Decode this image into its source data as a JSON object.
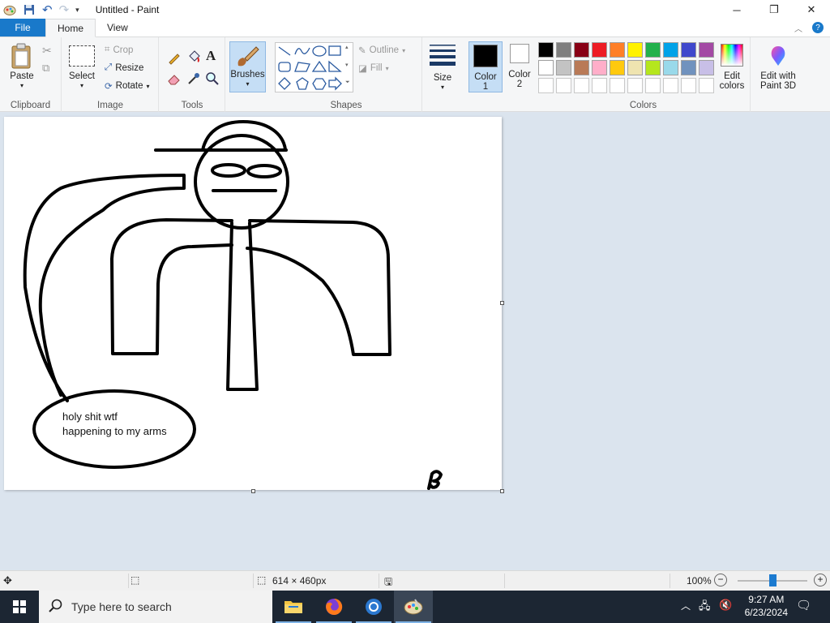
{
  "window": {
    "title": "Untitled - Paint",
    "minimize": "─",
    "maximize": "❐",
    "close": "✕"
  },
  "tabs": [
    {
      "label": "File"
    },
    {
      "label": "Home"
    },
    {
      "label": "View"
    }
  ],
  "ribbon": {
    "clipboard": {
      "group_label": "Clipboard",
      "paste": "Paste"
    },
    "image": {
      "group_label": "Image",
      "select": "Select",
      "crop": "Crop",
      "resize": "Resize",
      "rotate": "Rotate"
    },
    "tools": {
      "group_label": "Tools"
    },
    "brushes": {
      "label": "Brushes"
    },
    "shapes": {
      "group_label": "Shapes",
      "outline": "Outline",
      "fill": "Fill"
    },
    "size": {
      "label": "Size"
    },
    "color1": {
      "label": "Color 1",
      "value": "#000000"
    },
    "color2": {
      "label": "Color 2",
      "value": "#ffffff"
    },
    "colors": {
      "group_label": "Colors",
      "edit_colors": "Edit colors",
      "row1": [
        "#000000",
        "#7f7f7f",
        "#880015",
        "#ed1c24",
        "#ff7f27",
        "#fff200",
        "#22b14c",
        "#00a2e8",
        "#3f48cc",
        "#a349a4"
      ],
      "row2": [
        "#ffffff",
        "#c3c3c3",
        "#b97a57",
        "#ffaec9",
        "#ffc90e",
        "#efe4b0",
        "#b5e61d",
        "#99d9ea",
        "#7092be",
        "#c8bfe7"
      ]
    },
    "paint3d": {
      "label": "Edit with Paint 3D"
    }
  },
  "canvas": {
    "bubble_text_line1": "holy shit wtf",
    "bubble_text_line2": "happening to my arms"
  },
  "status": {
    "image_size": "614 × 460px",
    "zoom": "100%",
    "zoom_level": 100
  },
  "taskbar": {
    "search_placeholder": "Type here to search",
    "time": "9:27 AM",
    "date": "6/23/2024"
  }
}
